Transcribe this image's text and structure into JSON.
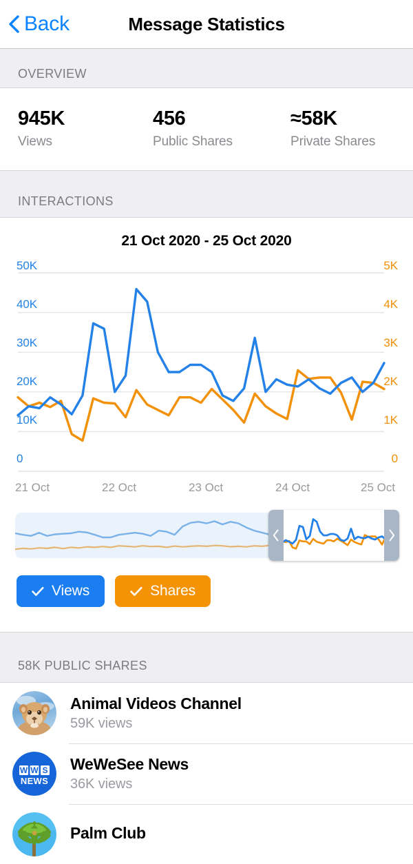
{
  "navbar": {
    "back_label": "Back",
    "title": "Message Statistics"
  },
  "overview": {
    "header": "OVERVIEW",
    "stats": [
      {
        "value": "945K",
        "label": "Views"
      },
      {
        "value": "456",
        "label": "Public Shares"
      },
      {
        "value": "≈58K",
        "label": "Private Shares"
      }
    ]
  },
  "interactions": {
    "header": "INTERACTIONS",
    "chart_title": "21 Oct 2020 - 25 Oct 2020",
    "legend": [
      {
        "label": "Views",
        "color": "#1a7ef0",
        "checked": true,
        "icon": "check-icon"
      },
      {
        "label": "Shares",
        "color": "#f59307",
        "checked": true,
        "icon": "check-icon"
      }
    ],
    "scrubber": {
      "left_handle_icon": "chevron-left-icon",
      "right_handle_icon": "chevron-right-icon"
    }
  },
  "public_shares": {
    "header": "58K PUBLIC SHARES",
    "items": [
      {
        "name": "Animal Videos Channel",
        "subtitle": "59K views",
        "avatar": "lion-cub-photo"
      },
      {
        "name": "WeWeSee News",
        "subtitle": "36K views",
        "avatar": "wws-news-logo"
      },
      {
        "name": "Palm Club",
        "subtitle": "",
        "avatar": "palm-tree-photo"
      }
    ]
  },
  "colors": {
    "accent_blue": "#0a84ff",
    "views_blue": "#2481e8",
    "shares_orange": "#f29007",
    "section_bg": "#eeeef3",
    "muted_text": "#8a8a8f"
  },
  "chart_data": {
    "type": "line",
    "title": "21 Oct 2020 - 25 Oct 2020",
    "xlabel": "",
    "grid": true,
    "legend_position": "below",
    "x_tick_labels": [
      "21 Oct",
      "22 Oct",
      "23 Oct",
      "24 Oct",
      "25 Oct"
    ],
    "left_axis": {
      "name": "Views",
      "color": "#2481e8",
      "tick_labels": [
        "0",
        "10K",
        "20K",
        "30K",
        "40K",
        "50K"
      ],
      "ylim": [
        0,
        55000
      ]
    },
    "right_axis": {
      "name": "Shares",
      "color": "#f29007",
      "tick_labels": [
        "0",
        "1K",
        "2K",
        "3K",
        "4K",
        "5K"
      ],
      "ylim": [
        0,
        5500
      ]
    },
    "series": [
      {
        "name": "Views",
        "axis": "left",
        "color": "#2481e8",
        "values": [
          15500,
          18000,
          17500,
          20500,
          18500,
          15800,
          21000,
          41000,
          39500,
          22000,
          26500,
          50500,
          47000,
          33000,
          27500,
          27500,
          29500,
          29500,
          27500,
          21000,
          19500,
          23000,
          37000,
          22000,
          25500,
          24000,
          23500,
          25500,
          23000,
          21500,
          24500,
          26000,
          22000,
          24500,
          30000
        ]
      },
      {
        "name": "Shares",
        "axis": "right",
        "color": "#f29007",
        "values": [
          2050,
          1800,
          1900,
          1780,
          1950,
          1030,
          850,
          2020,
          1900,
          1880,
          1500,
          2250,
          1850,
          1700,
          1550,
          2050,
          2050,
          1900,
          2280,
          1990,
          1700,
          1350,
          2150,
          1800,
          1600,
          1450,
          2800,
          2560,
          2600,
          2600,
          2180,
          1430,
          2480,
          2450,
          2280
        ]
      }
    ],
    "minimap": {
      "views_values": [
        2350,
        2200,
        2100,
        2400,
        2100,
        2250,
        2300,
        2350,
        2500,
        2430,
        2200,
        1950,
        1960,
        2200,
        2300,
        2400,
        2300,
        2100,
        2600,
        2500,
        2200,
        3000,
        3350,
        3450,
        3300,
        3500,
        3200,
        3450,
        3300,
        2900,
        2600,
        2400,
        2200,
        2100,
        1800,
        1650,
        1700,
        1600,
        1550,
        1450,
        1500,
        1700,
        1400,
        1350,
        1200,
        1150,
        1250,
        1100,
        1000
      ],
      "shares_values": [
        820,
        900,
        850,
        950,
        900,
        1000,
        880,
        1000,
        940,
        1050,
        1000,
        1080,
        1000,
        1150,
        1100,
        1050,
        1150,
        1080,
        1100,
        1000,
        1120,
        1050,
        1100,
        1150,
        1100,
        1180,
        1150,
        1060,
        1100,
        1050,
        1150,
        1100,
        1200,
        1050,
        1150,
        1100,
        1000,
        1050,
        1150,
        1000,
        1050,
        1100,
        1000,
        1050,
        1000,
        1100,
        1050,
        1000,
        1050
      ],
      "selection": {
        "start_fraction": 0.66,
        "end_fraction": 1.0
      }
    }
  }
}
